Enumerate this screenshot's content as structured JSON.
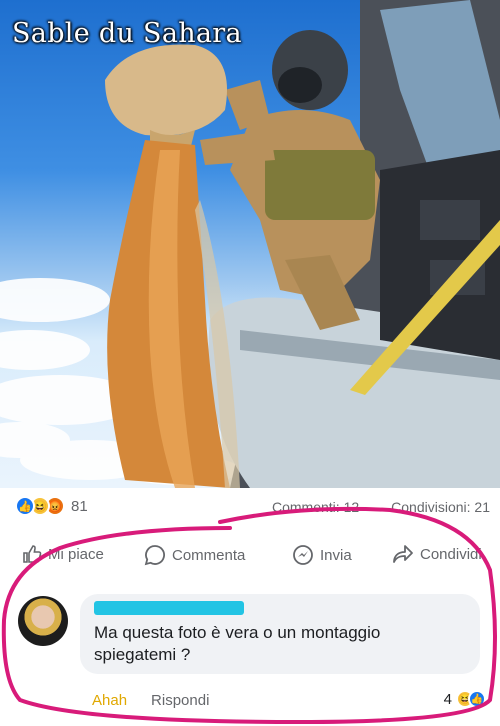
{
  "photo": {
    "caption": "Sable du Sahara"
  },
  "stats": {
    "reaction_count": "81",
    "comments": "Commenti: 12",
    "shares": "Condivisioni: 21"
  },
  "actions": {
    "like": "Mi piace",
    "comment": "Commenta",
    "send": "Invia",
    "share": "Condividi"
  },
  "comment": {
    "text": "Ma questa foto è vera o un montaggio spiegatemi ?",
    "reaction_label": "Ahah",
    "reply_label": "Rispondi",
    "reaction_count": "4"
  },
  "colors": {
    "facebook_blue": "#1877f2",
    "haha_yellow": "#f7c33b",
    "marker_pink": "#d81b7a"
  }
}
